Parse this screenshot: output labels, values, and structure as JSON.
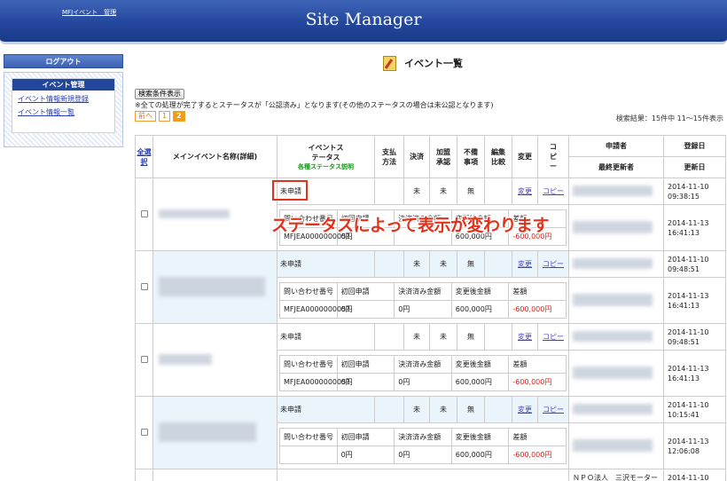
{
  "header": {
    "brand": "MFJイベント　管理",
    "title": "Site Manager"
  },
  "sidebar": {
    "logout": "ログアウト",
    "section_title": "イベント管理",
    "items": [
      "イベント情報新規登録",
      "イベント情報一覧"
    ]
  },
  "page": {
    "title": "イベント一覧",
    "search_button": "検索条件表示",
    "note": "※全ての処理が完了するとステータスが「公認済み」となります(その他のステータスの場合は未公認となります)",
    "pager": {
      "prev": "前へ",
      "pages": [
        "1",
        "2"
      ],
      "current": "2"
    },
    "result": "検索結果：15件中 11～15件表示"
  },
  "table": {
    "headers": {
      "select_all": "全選択",
      "name": "メインイベント名称(詳細)",
      "status": "イベントステータス",
      "status_link": "各種ステータス説明",
      "payment_method": "支払方法",
      "settlement": "決済",
      "member_approval": "加盟承認",
      "defect": "不備事項",
      "edit_compare": "編集比較",
      "change": "変更",
      "copy": "コピー",
      "applicant": "申請者",
      "last_updater": "最終更新者",
      "registered": "登録日",
      "updated": "更新日"
    },
    "sub_headers": [
      "問い合わせ番号",
      "初回申請",
      "決済済み金額",
      "変更後金額",
      "差額"
    ],
    "rows": [
      {
        "status": "未申請",
        "settlement": "未",
        "approval": "未",
        "defect": "無",
        "change": "変更",
        "copy": "コピー",
        "inquiry": "MFJEA0000000051",
        "first": "0円",
        "settled": "",
        "changed": "600,000円",
        "diff": "-600,000円",
        "reg_date": "2014-11-10",
        "reg_time": "09:38:15",
        "upd_date": "2014-11-13",
        "upd_time": "16:41:13",
        "applicant_extra": ""
      },
      {
        "status": "未申請",
        "settlement": "未",
        "approval": "未",
        "defect": "無",
        "change": "変更",
        "copy": "コピー",
        "inquiry": "MFJEA0000000051",
        "first": "0円",
        "settled": "0円",
        "changed": "600,000円",
        "diff": "-600,000円",
        "reg_date": "2014-11-10",
        "reg_time": "09:48:51",
        "upd_date": "2014-11-13",
        "upd_time": "16:41:13",
        "applicant_extra": ""
      },
      {
        "status": "未申請",
        "settlement": "未",
        "approval": "未",
        "defect": "無",
        "change": "変更",
        "copy": "コピー",
        "inquiry": "MFJEA0000000051",
        "first": "0円",
        "settled": "0円",
        "changed": "600,000円",
        "diff": "-600,000円",
        "reg_date": "2014-11-10",
        "reg_time": "09:48:51",
        "upd_date": "2014-11-13",
        "upd_time": "16:41:13",
        "applicant_extra": ""
      },
      {
        "status": "未申請",
        "settlement": "未",
        "approval": "未",
        "defect": "無",
        "change": "変更",
        "copy": "コピー",
        "inquiry": "",
        "first": "0円",
        "settled": "0円",
        "changed": "600,000円",
        "diff": "-600,000円",
        "reg_date": "2014-11-10",
        "reg_time": "10:15:41",
        "upd_date": "2014-11-13",
        "upd_time": "12:06:08",
        "applicant_extra": "ＮＰＯ法人　三沢モーター"
      }
    ],
    "last_row": {
      "applicant": "ＮＰＯ法人　三沢モーター",
      "reg_date": "2014-11-10"
    }
  },
  "annotation": "ステータスによって表示が変わります",
  "colors": {
    "header": "#23479c",
    "accent": "#e2321b",
    "link": "#4a3fc4"
  }
}
